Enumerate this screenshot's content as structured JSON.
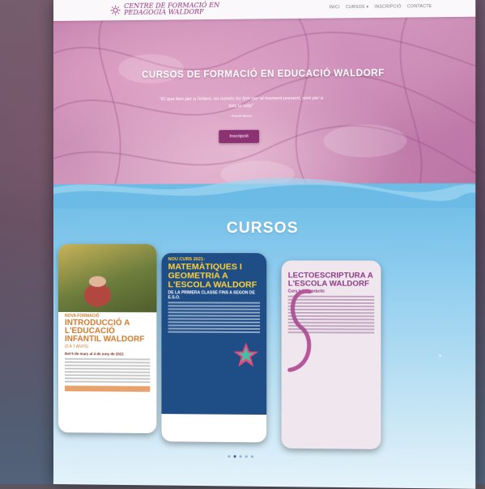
{
  "site": {
    "logo_line1": "CENTRE DE FORMACIÓ EN",
    "logo_line2": "PEDAGOGIA WALDORF"
  },
  "nav": {
    "items": [
      "INICI",
      "CURSOS",
      "INSCRIPCIÓ",
      "CONTACTE"
    ]
  },
  "hero": {
    "title": "CURSOS DE FORMACIÓ EN EDUCACIÓ WALDORF",
    "quote": "\"El que fem per a l'infant, no només ho fem per al moment present, sinó per a tota la vida\"",
    "author": "- Rudolf Steiner",
    "cta_label": "Inscripció"
  },
  "section": {
    "title": "CURSOS"
  },
  "cards": [
    {
      "tag": "NOVA FORMACIÓ",
      "title": "INTRODUCCIÓ A L'EDUCACIÓ INFANTIL WALDORF",
      "subtitle": "(0 A 7 ANYS)",
      "dates": "Del 5 de març al 4 de juny de 2021"
    },
    {
      "tag": "NOU CURS 2021:",
      "title": "MATEMÀTIQUES I GEOMETRIA A L'ESCOLA WALDORF",
      "subtitle": "DE LA PRIMERA CLASSE FINS A SEGON DE E.S.O."
    },
    {
      "title": "LECTOESCRIPTURA A L'ESCOLA WALDORF",
      "subtitle": "Curs teòric-pràctic"
    }
  ],
  "colors": {
    "brand": "#8d3175",
    "sky": "#6bbbe6",
    "card2_accent": "#ffd23a",
    "card1_accent": "#d27a2d"
  },
  "carousel": {
    "slides": 5,
    "active": 1
  }
}
